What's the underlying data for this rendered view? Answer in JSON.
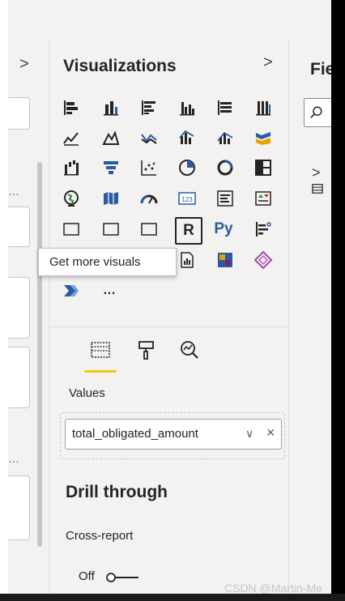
{
  "visualizations_pane": {
    "title": "Visualizations",
    "collapse_glyph": ">",
    "more_glyph": "…",
    "r_visual_label": "R",
    "py_visual_label": "Py",
    "values_label": "Values",
    "field": {
      "name": "total_obligated_amount",
      "chevron": "∨",
      "remove": "×"
    },
    "drill_through_title": "Drill through",
    "cross_report_label": "Cross-report",
    "cross_report_value": "Off"
  },
  "fields_pane": {
    "title": "Fie",
    "expand_glyph": ">"
  },
  "filters_pane": {
    "expand_glyph": ">",
    "more_glyph": "…"
  },
  "tooltip": {
    "text": "Get more visuals"
  },
  "watermark": "CSDN @Martin-Me",
  "colors": {
    "accent_yellow": "#f2c811",
    "icon_blue": "#2a5aa0",
    "icon_dark": "#252423",
    "pane_bg": "#f3f2f1"
  }
}
